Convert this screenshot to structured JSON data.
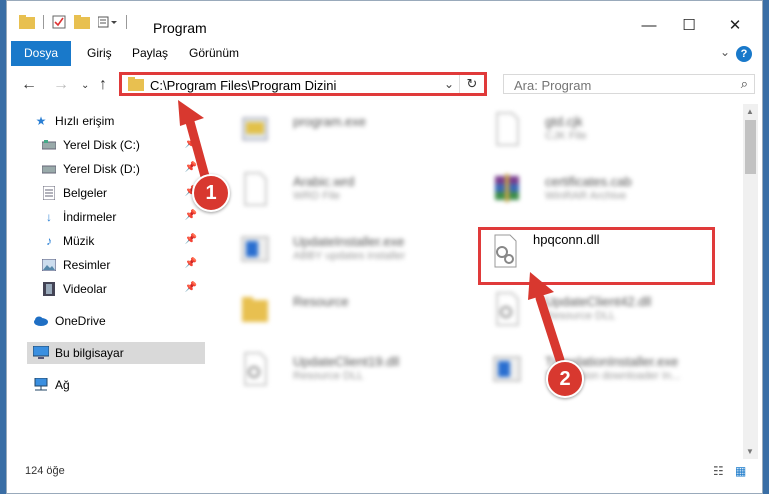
{
  "window": {
    "title": "Program",
    "controls": {
      "minimize": "—",
      "maximize": "☐",
      "close": "✕"
    }
  },
  "ribbon": {
    "tabs": [
      {
        "label": "Dosya",
        "active": true
      },
      {
        "label": "Giriş",
        "active": false
      },
      {
        "label": "Paylaş",
        "active": false
      },
      {
        "label": "Görünüm",
        "active": false
      }
    ],
    "help": "?",
    "accent": "#1979ca"
  },
  "address": {
    "path": "C:\\Program Files\\Program Dizini",
    "search_placeholder": "Ara: Program"
  },
  "sidebar": {
    "items": [
      {
        "label": "Hızlı erişim",
        "icon": "star-icon"
      },
      {
        "label": "Yerel Disk (C:)",
        "icon": "drive-icon",
        "pinned": true
      },
      {
        "label": "Yerel Disk (D:)",
        "icon": "drive-icon",
        "pinned": true
      },
      {
        "label": "Belgeler",
        "icon": "documents-icon",
        "pinned": true
      },
      {
        "label": "İndirmeler",
        "icon": "download-icon",
        "pinned": true
      },
      {
        "label": "Müzik",
        "icon": "music-icon",
        "pinned": true
      },
      {
        "label": "Resimler",
        "icon": "pictures-icon",
        "pinned": true
      },
      {
        "label": "Videolar",
        "icon": "video-icon",
        "pinned": true
      },
      {
        "label": "OneDrive",
        "icon": "cloud-icon"
      },
      {
        "label": "Bu bilgisayar",
        "icon": "computer-icon",
        "selected": true
      },
      {
        "label": "Ağ",
        "icon": "network-icon"
      }
    ]
  },
  "files": [
    {
      "name": "program.exe",
      "type": "",
      "icon": "exe-icon"
    },
    {
      "name": "gtd.cjk",
      "type": "CJK File",
      "icon": "blank-file-icon"
    },
    {
      "name": "Arabic.wrd",
      "type": "WRD File",
      "icon": "blank-file-icon"
    },
    {
      "name": "certificates.cab",
      "type": "WinRAR Archive",
      "icon": "archive-icon"
    },
    {
      "name": "UpdateInstaller.exe",
      "type": "ABBY updates installer",
      "icon": "installer-icon"
    },
    {
      "name": "hpqconn.dll",
      "type": "",
      "icon": "dll-gear-icon",
      "highlighted": true
    },
    {
      "name": "Resource",
      "type": "",
      "icon": "folder-icon"
    },
    {
      "name": "UpdateClient42.dll",
      "type": "Resource DLL",
      "icon": "dll-gear-icon"
    },
    {
      "name": "UpdateClient19.dll",
      "type": "Resource DLL",
      "icon": "dll-gear-icon"
    },
    {
      "name": "TranslationInstaller.exe",
      "type": "Translation downloader In...",
      "icon": "installer-icon"
    }
  ],
  "status": {
    "count": "124 öğe"
  },
  "callouts": {
    "one": "1",
    "two": "2"
  },
  "colors": {
    "highlight": "#e03a3a",
    "callout": "#d8382f"
  }
}
